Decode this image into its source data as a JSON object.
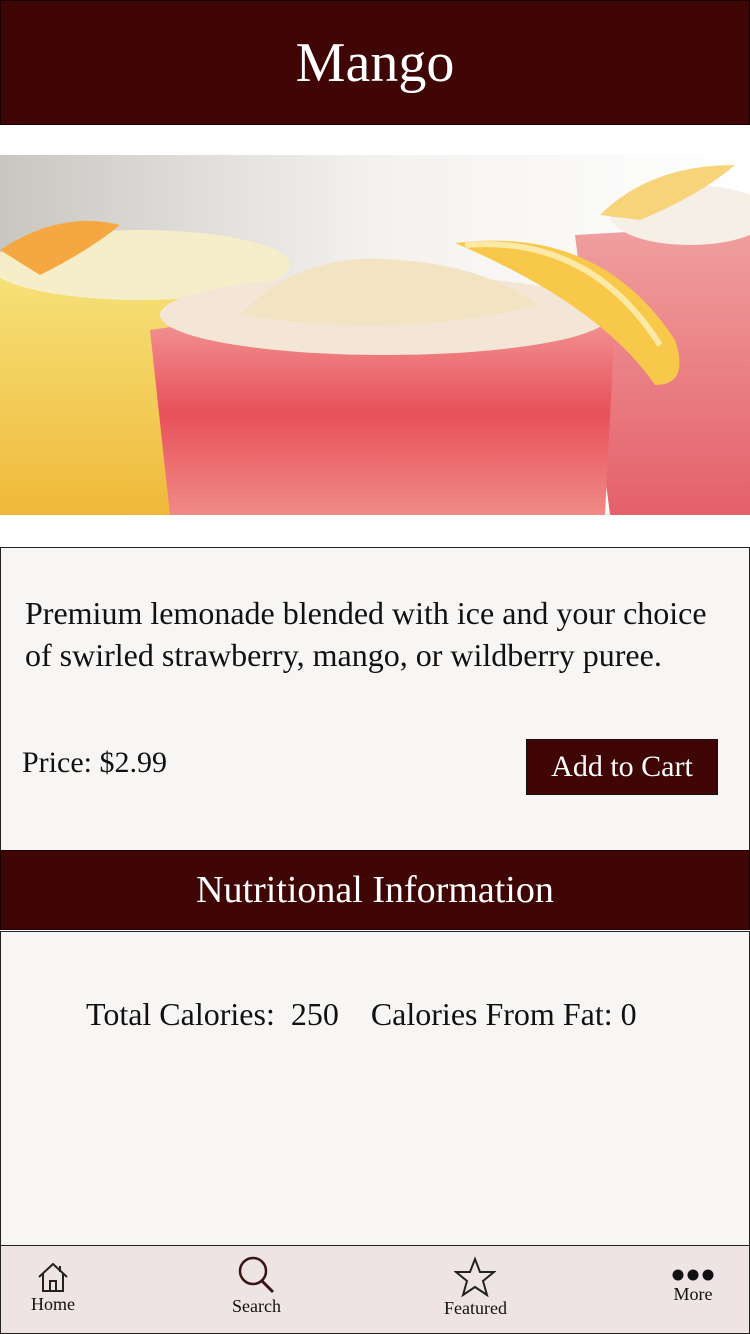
{
  "header": {
    "title": "Mango"
  },
  "hero": {
    "image_description_icon": "drink-photo"
  },
  "product": {
    "description": "Premium lemonade blended with ice and your choice of swirled strawberry, mango, or wildberry puree.",
    "price": "Price: $2.99",
    "add_to_cart_label": "Add to Cart"
  },
  "nutrition": {
    "title": "Nutritional Information",
    "total_calories_label": "Total Calories:",
    "total_calories_value": "250",
    "fat_calories_label": "Calories From Fat:",
    "fat_calories_value": "0"
  },
  "tabbar": {
    "tabs": [
      {
        "label": "Home",
        "icon": "home-icon"
      },
      {
        "label": "Search",
        "icon": "search-icon"
      },
      {
        "label": "Featured",
        "icon": "star-icon"
      },
      {
        "label": "More",
        "icon": "more-icon"
      }
    ]
  },
  "colors": {
    "brand": "#400606",
    "card_bg": "#f7f6f4",
    "tabbar_bg": "#ede4e3"
  }
}
